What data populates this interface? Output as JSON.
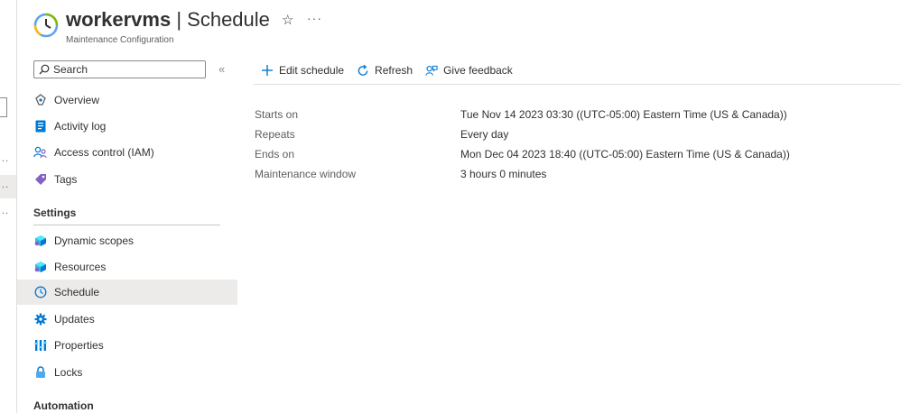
{
  "header": {
    "resource_name": "workervms",
    "page_name": "Schedule",
    "separator": "|",
    "subtitle": "Maintenance Configuration",
    "more": "···"
  },
  "search": {
    "placeholder": "Search",
    "collapse": "«"
  },
  "nav": {
    "items": [
      {
        "label": "Overview",
        "icon": "overview-icon"
      },
      {
        "label": "Activity log",
        "icon": "activity-log-icon"
      },
      {
        "label": "Access control (IAM)",
        "icon": "iam-icon"
      },
      {
        "label": "Tags",
        "icon": "tag-icon"
      }
    ],
    "settings_heading": "Settings",
    "settings_items": [
      {
        "label": "Dynamic scopes",
        "icon": "cube-icon"
      },
      {
        "label": "Resources",
        "icon": "cube-icon"
      },
      {
        "label": "Schedule",
        "icon": "clock-icon",
        "selected": true
      },
      {
        "label": "Updates",
        "icon": "gear-icon"
      },
      {
        "label": "Properties",
        "icon": "properties-icon"
      },
      {
        "label": "Locks",
        "icon": "lock-icon"
      }
    ],
    "automation_heading": "Automation"
  },
  "toolbar": {
    "edit_label": "Edit schedule",
    "refresh_label": "Refresh",
    "feedback_label": "Give feedback"
  },
  "details": [
    {
      "label": "Starts on",
      "value": "Tue Nov 14 2023 03:30 ((UTC-05:00) Eastern Time (US & Canada))"
    },
    {
      "label": "Repeats",
      "value": "Every day"
    },
    {
      "label": "Ends on",
      "value": "Mon Dec 04 2023 18:40 ((UTC-05:00) Eastern Time (US & Canada))"
    },
    {
      "label": "Maintenance window",
      "value": "3 hours 0 minutes"
    }
  ],
  "left_remnant": {
    "dots": "..."
  },
  "colors": {
    "accent": "#0078d4",
    "selected_bg": "#edebe9",
    "text": "#323130"
  }
}
